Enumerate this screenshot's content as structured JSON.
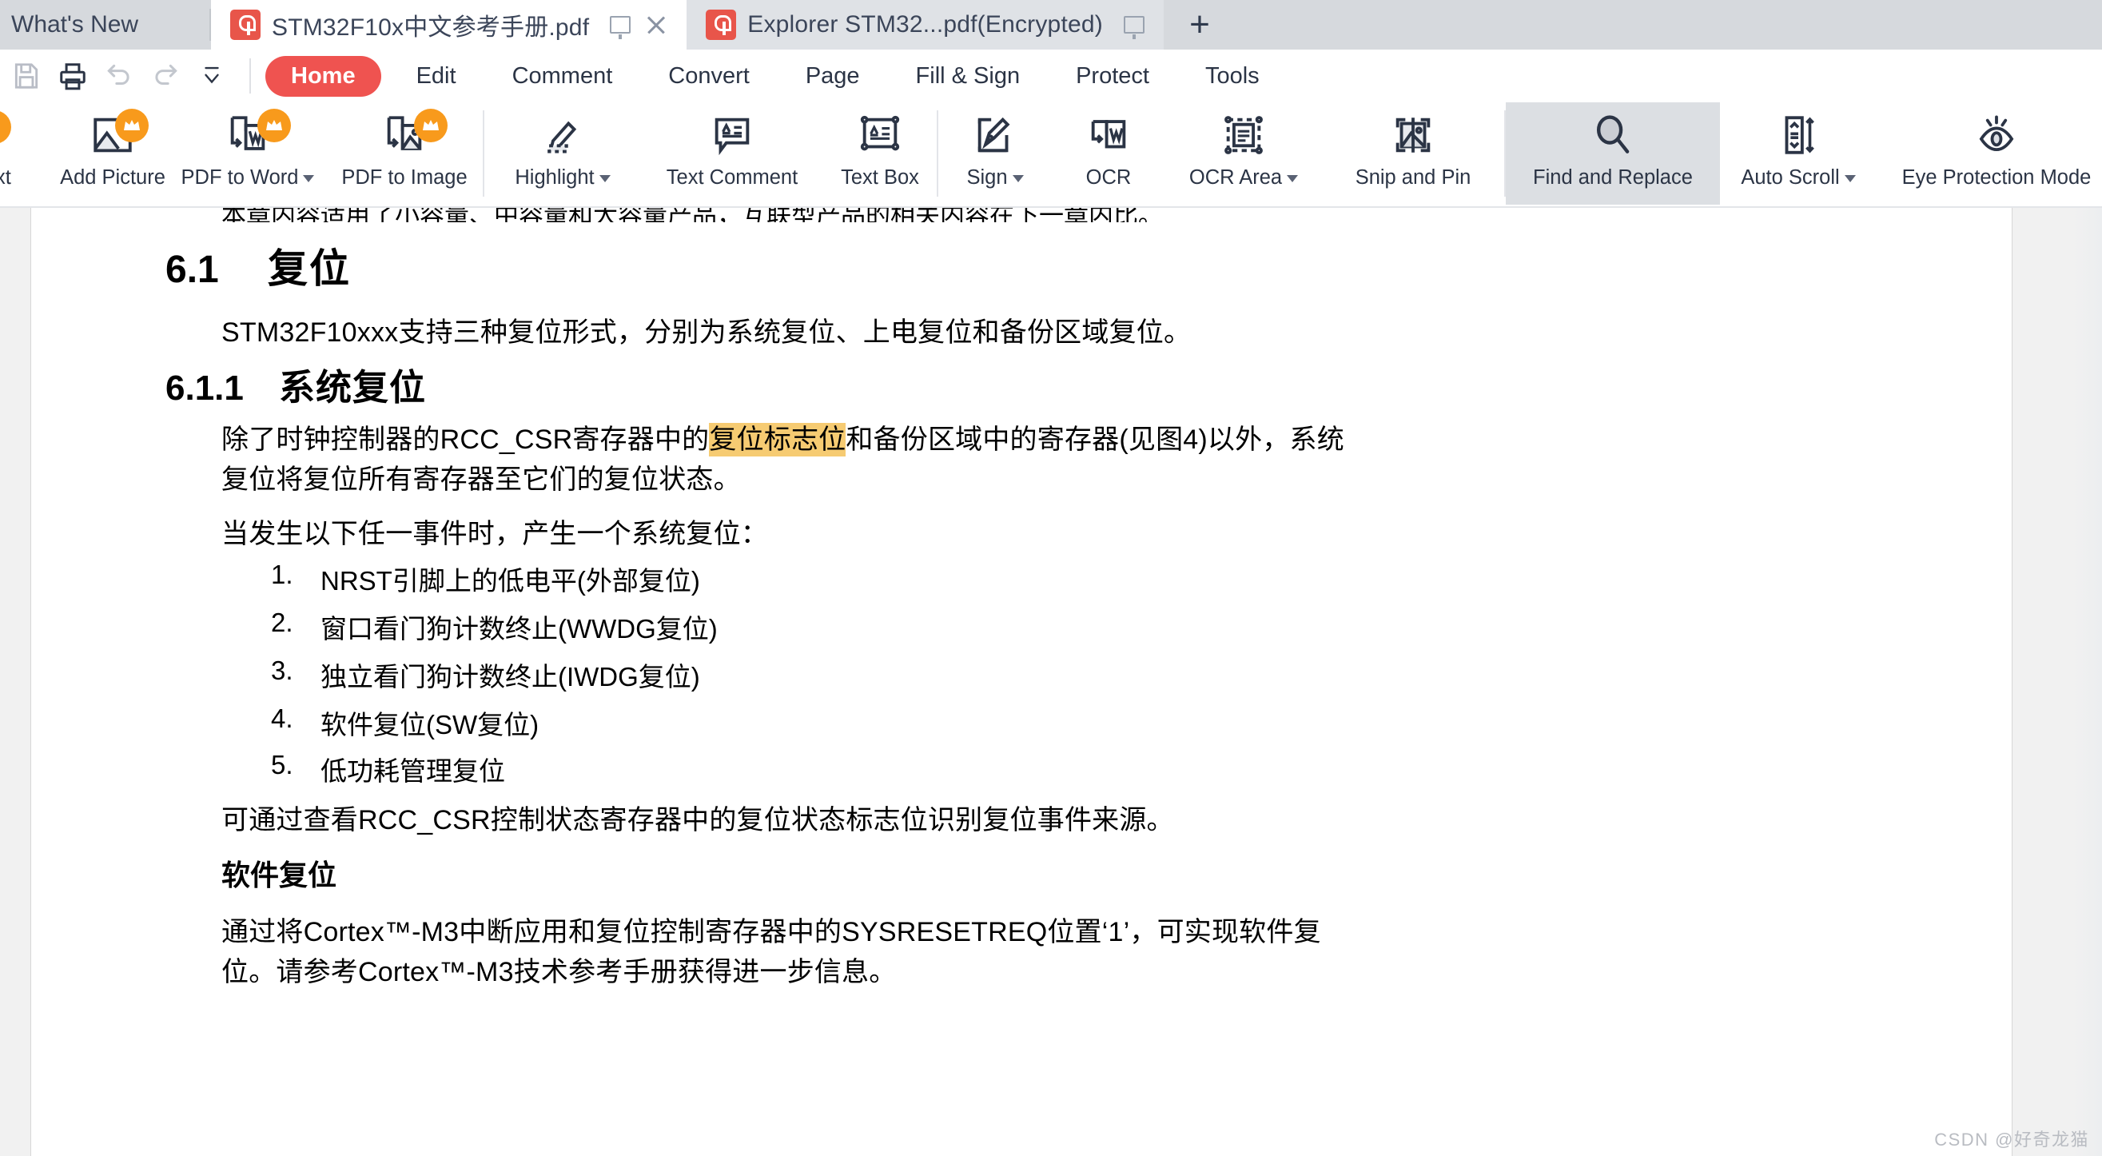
{
  "tabs": [
    {
      "label": "What's New",
      "type": "whatsnew",
      "icon": null,
      "has_close": false,
      "has_screen": false
    },
    {
      "label": "STM32F10x中文参考手册.pdf",
      "type": "active",
      "icon": "pdf-icon",
      "has_close": true,
      "has_screen": true
    },
    {
      "label": "Explorer STM32...pdf(Encrypted)",
      "type": "inactive",
      "icon": "pdf-icon",
      "has_close": false,
      "has_screen": true
    }
  ],
  "tabbar": {
    "new_tab_label": "+"
  },
  "quick_access": [
    {
      "name": "save-icon"
    },
    {
      "name": "print-icon"
    },
    {
      "name": "undo-icon"
    },
    {
      "name": "redo-icon"
    },
    {
      "name": "customize-toolbar-icon"
    }
  ],
  "menu": {
    "items": [
      {
        "label": "Home",
        "active": true
      },
      {
        "label": "Edit",
        "active": false
      },
      {
        "label": "Comment",
        "active": false
      },
      {
        "label": "Convert",
        "active": false
      },
      {
        "label": "Page",
        "active": false
      },
      {
        "label": "Fill & Sign",
        "active": false
      },
      {
        "label": "Protect",
        "active": false
      },
      {
        "label": "Tools",
        "active": false
      }
    ]
  },
  "ribbon": {
    "items": [
      {
        "label": "xt",
        "icon": "add-text-icon",
        "pro": true,
        "caret": false,
        "selected": false,
        "clipped": true
      },
      {
        "label": "Add Picture",
        "icon": "add-picture-icon",
        "pro": true,
        "caret": false,
        "selected": false
      },
      {
        "label": "PDF to Word",
        "icon": "pdf-to-word-icon",
        "pro": true,
        "caret": true,
        "selected": false
      },
      {
        "label": "PDF to Image",
        "icon": "pdf-to-image-icon",
        "pro": true,
        "caret": false,
        "selected": false
      },
      {
        "label": "Highlight",
        "icon": "highlight-icon",
        "pro": false,
        "caret": true,
        "selected": false
      },
      {
        "label": "Text Comment",
        "icon": "text-comment-icon",
        "pro": false,
        "caret": false,
        "selected": false
      },
      {
        "label": "Text Box",
        "icon": "text-box-icon",
        "pro": false,
        "caret": false,
        "selected": false
      },
      {
        "label": "Sign",
        "icon": "sign-icon",
        "pro": false,
        "caret": true,
        "selected": false
      },
      {
        "label": "OCR",
        "icon": "ocr-icon",
        "pro": false,
        "caret": false,
        "selected": false
      },
      {
        "label": "OCR Area",
        "icon": "ocr-area-icon",
        "pro": false,
        "caret": true,
        "selected": false
      },
      {
        "label": "Snip and Pin",
        "icon": "snip-and-pin-icon",
        "pro": false,
        "caret": false,
        "selected": false
      },
      {
        "label": "Find and Replace",
        "icon": "find-and-replace-icon",
        "pro": false,
        "caret": false,
        "selected": true
      },
      {
        "label": "Auto Scroll",
        "icon": "auto-scroll-icon",
        "pro": false,
        "caret": true,
        "selected": false
      },
      {
        "label": "Eye Protection Mode",
        "icon": "eye-protection-icon",
        "pro": false,
        "caret": false,
        "selected": false
      }
    ]
  },
  "document": {
    "clipped_top_line": "本章内容适用了小容量、中容量和大容量产品，互联型产品的相关内容在下一章内比。",
    "heading_61_number": "6.1",
    "heading_61_text": "复位",
    "para_1": "STM32F10xxx支持三种复位形式，分别为系统复位、上电复位和备份区域复位。",
    "heading_611_number": "6.1.1",
    "heading_611_text": "系统复位",
    "para_2_pre": "除了时钟控制器的RCC_CSR寄存器中的",
    "para_2_highlight": "复位标志位",
    "para_2_post": "和备份区域中的寄存器(见图4)以外，系统",
    "para_2_line2": "复位将复位所有寄存器至它们的复位状态。",
    "para_3": "当发生以下任一事件时，产生一个系统复位：",
    "list": [
      {
        "n": "1.",
        "text": "NRST引脚上的低电平(外部复位)"
      },
      {
        "n": "2.",
        "text": "窗口看门狗计数终止(WWDG复位)"
      },
      {
        "n": "3.",
        "text": "独立看门狗计数终止(IWDG复位)"
      },
      {
        "n": "4.",
        "text": "软件复位(SW复位)"
      },
      {
        "n": "5.",
        "text": "低功耗管理复位"
      }
    ],
    "para_4": "可通过查看RCC_CSR控制状态寄存器中的复位状态标志位识别复位事件来源。",
    "sub_heading": "软件复位",
    "para_5_line1": "通过将Cortex™-M3中断应用和复位控制寄存器中的SYSRESETREQ位置‘1’，可实现软件复",
    "para_5_line2": "位。请参考Cortex™-M3技术参考手册获得进一步信息。",
    "watermark": "CSDN @好奇龙猫"
  },
  "colors": {
    "accent": "#ef5350",
    "pro_badge": "#f89a1c",
    "highlight": "#f6cb72",
    "tab_inactive": "#dfe2e6",
    "tabbar_bg": "#d6d9dd",
    "selected_tool": "#dcdfe3"
  }
}
